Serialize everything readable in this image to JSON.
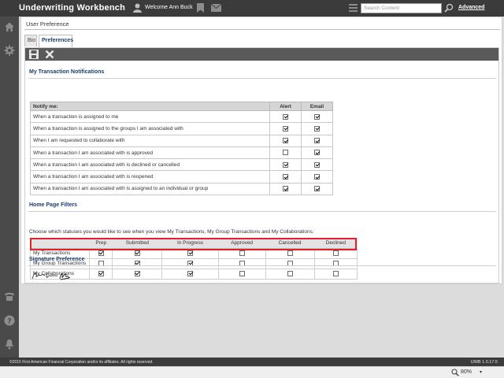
{
  "app": {
    "title": "Underwriting Workbench",
    "welcome": "Welcome Ann Buck",
    "search_placeholder": "Search Content",
    "advanced_label": "Advanced"
  },
  "panel": {
    "title": "User Preference",
    "tabs": [
      {
        "label": "Bio",
        "active": false
      },
      {
        "label": "Preferences",
        "active": true
      }
    ]
  },
  "notifications": {
    "section_title": "My Transaction Notifications",
    "header": {
      "notify": "Notify me:",
      "alert": "Alert",
      "email": "Email"
    },
    "rows": [
      {
        "label": "When a transaction is assigned to me",
        "alert": true,
        "email": true
      },
      {
        "label": "When a transaction is assigned to the groups I am associated with",
        "alert": true,
        "email": true
      },
      {
        "label": "When I am requested to collaborate with",
        "alert": true,
        "email": true
      },
      {
        "label": "When a transaction I am associated with is approved",
        "alert": false,
        "email": true
      },
      {
        "label": "When a transaction I am associated with is declined or cancelled",
        "alert": true,
        "email": true
      },
      {
        "label": "When a transaction I am associated with is reopened",
        "alert": true,
        "email": true
      },
      {
        "label": "When a transaction I am associated with is assigned to an individual or group",
        "alert": true,
        "email": true
      }
    ]
  },
  "filters": {
    "section_title": "Home Page Filters",
    "description": "Choose which statuses you would like to see when you view My Transactions, My Group Transactions and My Collaborations.",
    "columns": [
      "Prep",
      "Submitted",
      "In Progress",
      "Approved",
      "Cancelled",
      "Declined"
    ],
    "rows": [
      {
        "label": "My Transactions",
        "values": [
          true,
          true,
          true,
          false,
          false,
          false
        ]
      },
      {
        "label": "My Group Transactions",
        "values": [
          false,
          true,
          true,
          false,
          false,
          false
        ]
      },
      {
        "label": "My Collaborations",
        "values": [
          true,
          true,
          true,
          false,
          false,
          false
        ]
      }
    ]
  },
  "signature": {
    "section_title": "Signature Preference"
  },
  "footer": {
    "copyright": "©2015 First American Financial Corporation and/or its affiliates. All rights reserved.",
    "version": "UWB 1.0.17.5"
  },
  "statusbar": {
    "zoom": "80%"
  },
  "colors": {
    "header_bg": "#3b3b3b",
    "section_title": "#1c3d6e",
    "highlight": "#e0202a"
  }
}
